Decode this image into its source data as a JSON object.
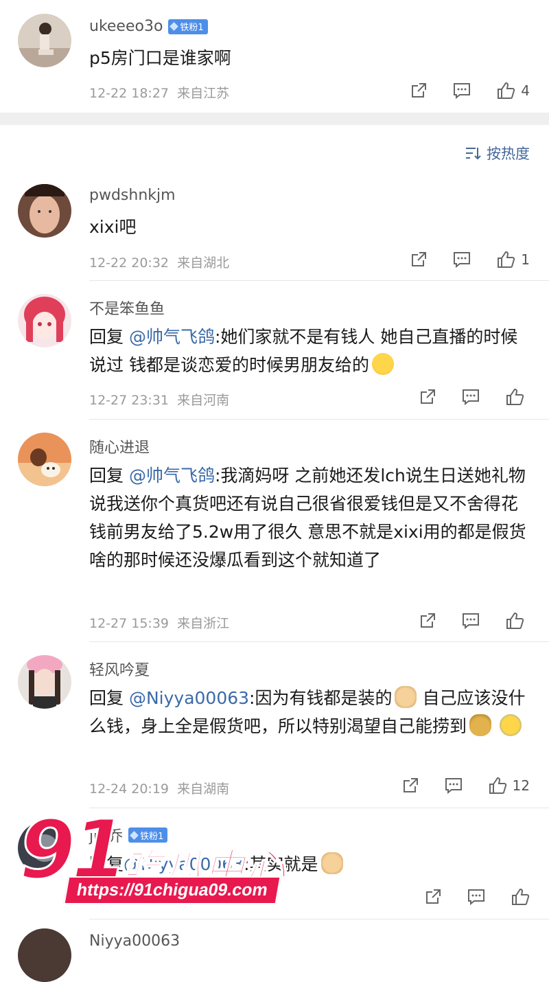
{
  "top_comment": {
    "user": "ukeeeo3o",
    "badge": "铁粉1",
    "text": "p5房门口是谁家啊",
    "time": "12-22 18:27",
    "location": "来自江苏",
    "likes": "4"
  },
  "sort": {
    "label": "按热度"
  },
  "comments": [
    {
      "user": "pwdshnkjm",
      "text": "xixi吧",
      "time": "12-22 20:32",
      "location": "来自湖北",
      "likes": "1"
    },
    {
      "user": "不是笨鱼鱼",
      "reply_prefix": "回复 ",
      "mention": "@帅气飞鸽",
      "text": ":她们家就不是有钱人 她自己直播的时候说过 钱都是谈恋爱的时候男朋友给的",
      "time": "12-27 23:31",
      "location": "来自河南",
      "likes": ""
    },
    {
      "user": "随心进退",
      "reply_prefix": "回复 ",
      "mention": "@帅气飞鸽",
      "text": ":我滴妈呀 之前她还发lch说生日送她礼物说我送你个真货吧还有说自己很省很爱钱但是又不舍得花钱前男友给了5.2w用了很久 意思不就是xixi用的都是假货啥的那时候还没爆瓜看到这个就知道了",
      "time": "12-27 15:39",
      "location": "来自浙江",
      "likes": ""
    },
    {
      "user": "轻风吟夏",
      "reply_prefix": "回复 ",
      "mention": "@Niyya00063",
      "text": ":因为有钱都是装的",
      "text_2": "自己应该没什么钱，身上全是假货吧，所以特别渴望自己能捞到",
      "time": "12-24 20:19",
      "location": "来自湖南",
      "likes": "12"
    },
    {
      "user": "ju 乔",
      "badge": "铁粉1",
      "reply_prefix": "回复",
      "mention": "@Niyya00063",
      "text": ":其实就是",
      "time": "",
      "location": "",
      "likes": ""
    }
  ],
  "partial_next_user": "Niyya00063",
  "watermark": {
    "big": "91",
    "cn": "吃瓜中心",
    "url": "https://91chigua09.com"
  },
  "colors": {
    "link": "#3b6aa8",
    "badge": "#4d8fe8",
    "watermark": "#e8194e"
  }
}
